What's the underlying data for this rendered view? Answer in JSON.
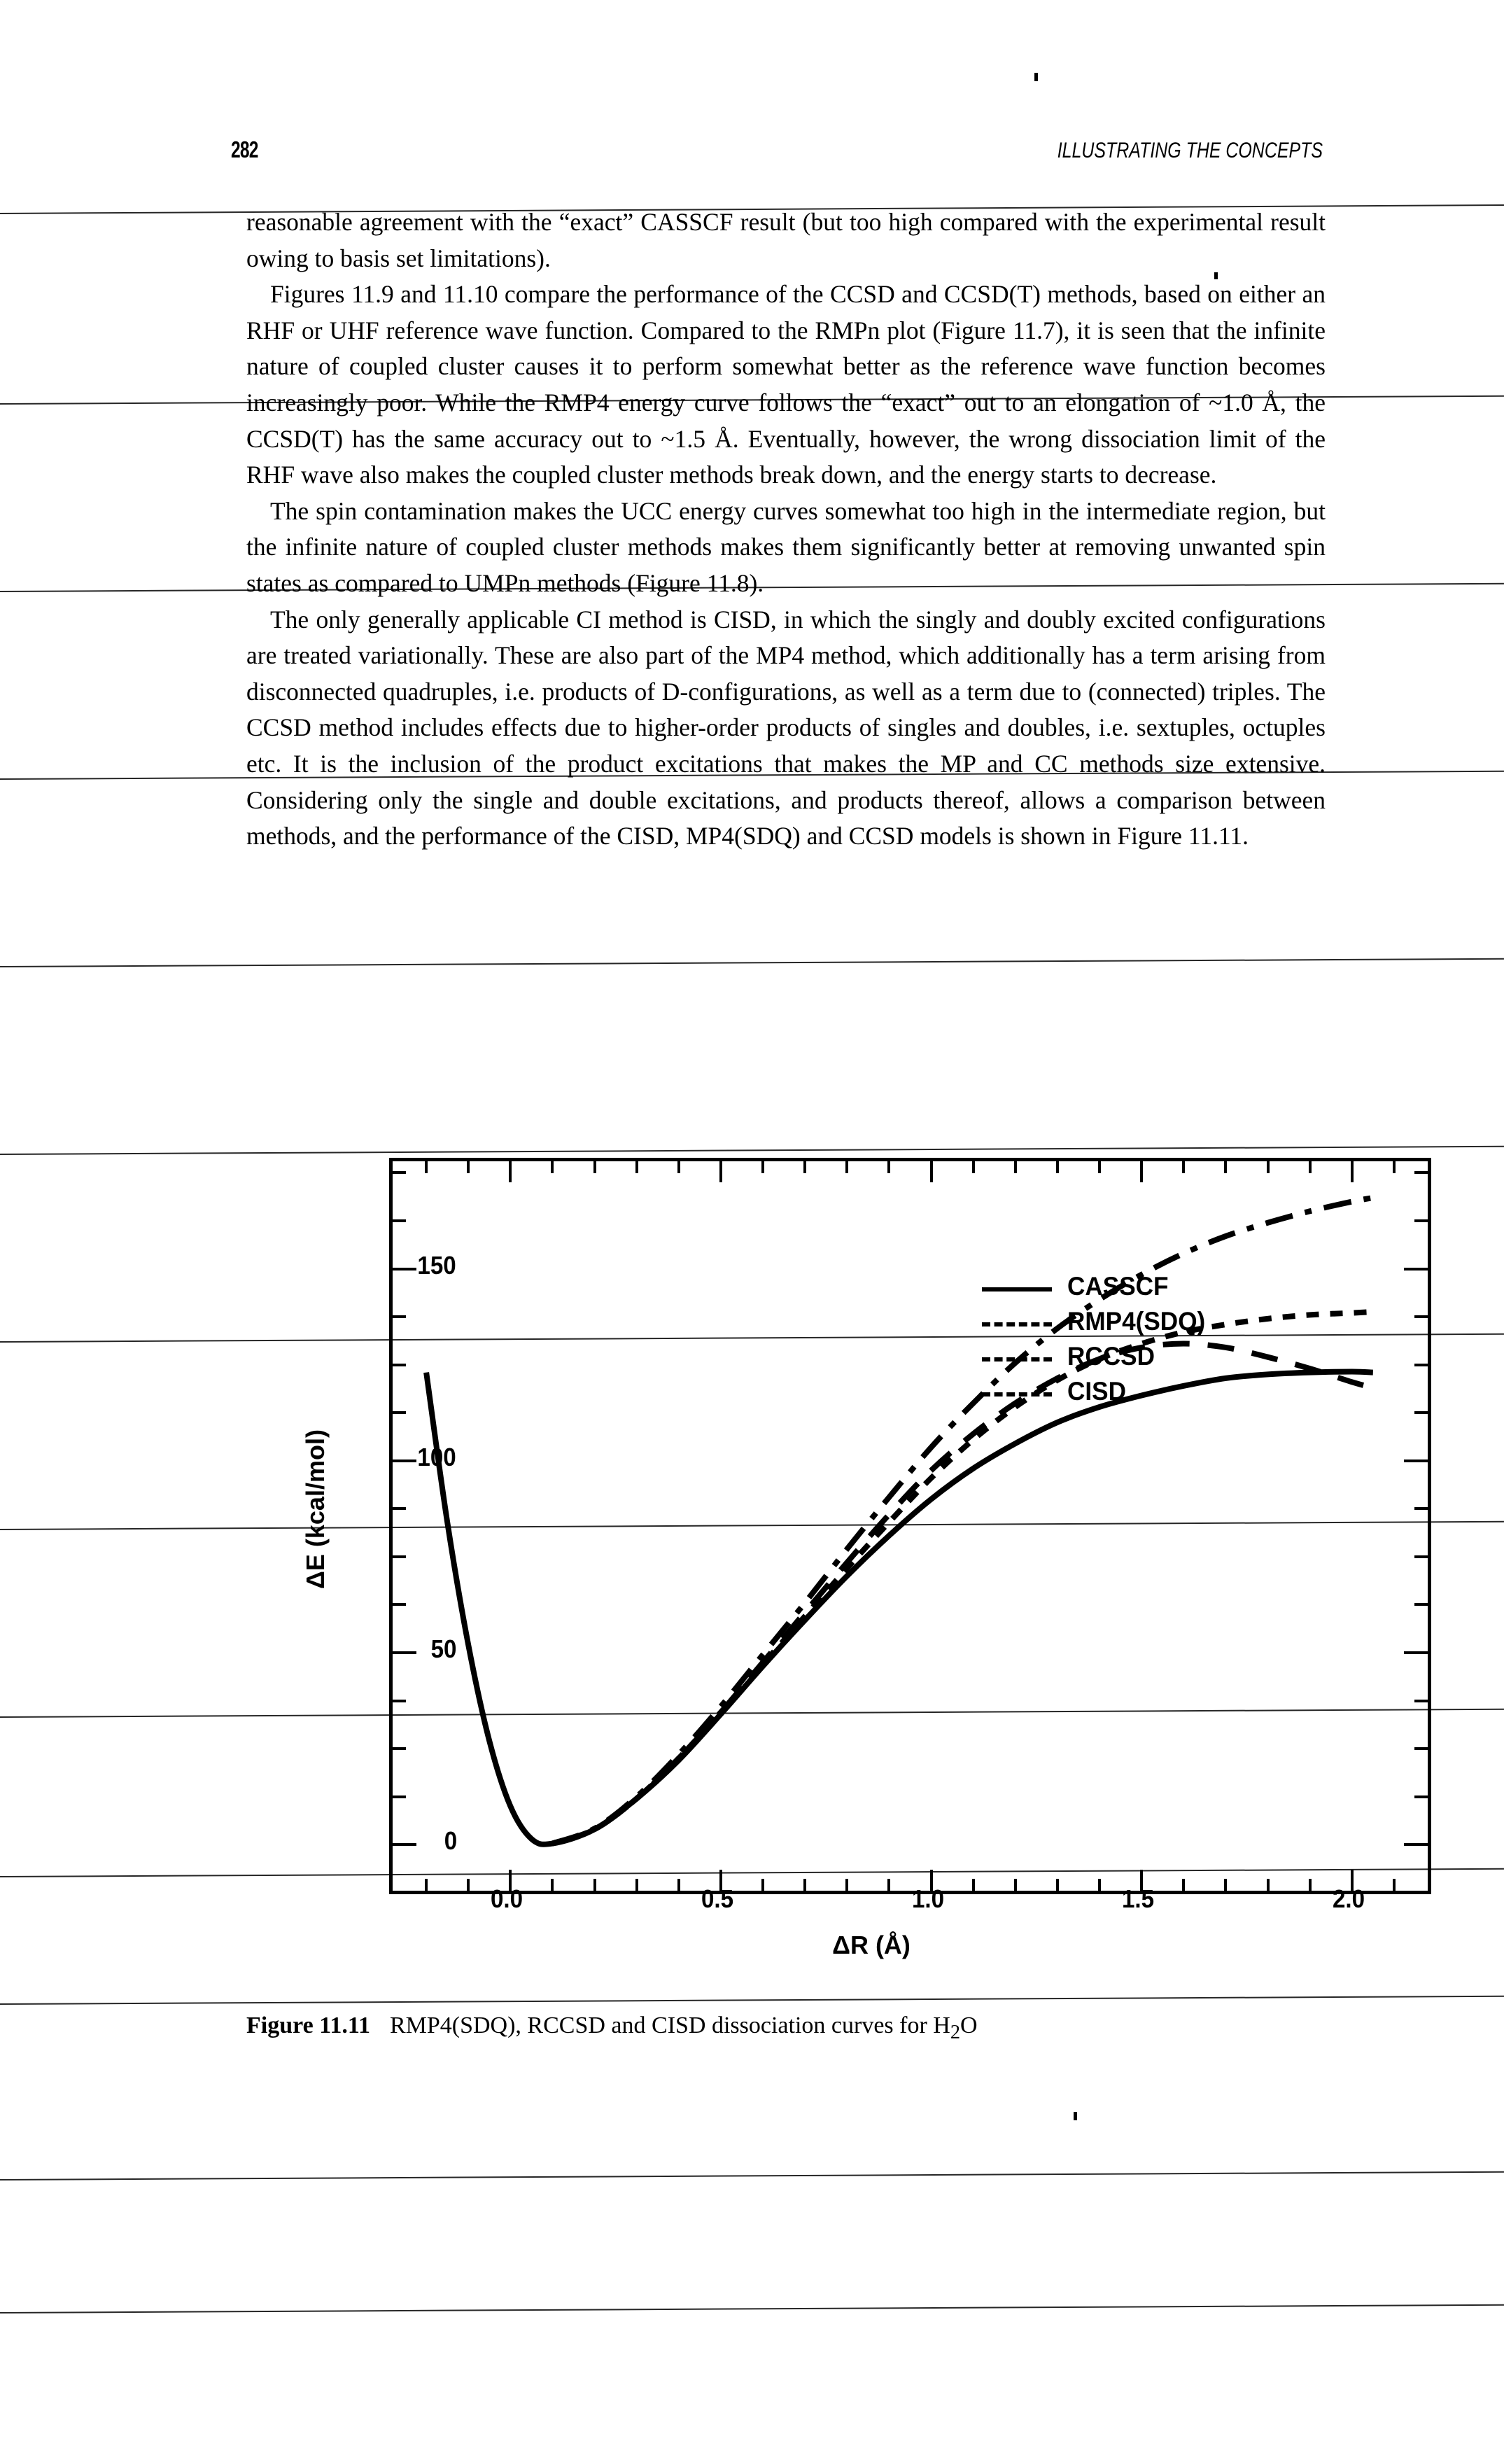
{
  "page": {
    "number": "282",
    "running_head": "ILLUSTRATING THE CONCEPTS"
  },
  "body": {
    "paragraphs": [
      "reasonable agreement with the “exact” CASSCF result (but too high compared with the experimental result owing to basis set limitations).",
      "Figures 11.9 and 11.10 compare the performance of the CCSD and CCSD(T) methods, based on either an RHF or UHF reference wave function. Compared to the RMPn plot (Figure 11.7), it is seen that the infinite nature of coupled cluster causes it to perform somewhat better as the reference wave function becomes increasingly poor. While the RMP4 energy curve follows the “exact” out to an elongation of ~1.0 Å, the CCSD(T) has the same accuracy out to ~1.5 Å. Eventually, however, the wrong dissociation limit of the RHF wave also makes the coupled cluster methods break down, and the energy starts to decrease.",
      "The spin contamination makes the UCC energy curves somewhat too high in the intermediate region, but the infinite nature of coupled cluster methods makes them significantly better at removing unwanted spin states as compared to UMPn methods (Figure 11.8).",
      "The only generally applicable CI method is CISD, in which the singly and doubly excited configurations are treated variationally. These are also part of the MP4 method, which additionally has a term arising from disconnected quadruples, i.e. products of D-configurations, as well as a term due to (connected) triples. The CCSD method includes effects due to higher-order products of singles and doubles, i.e. sextuples, octuples etc. It is the inclusion of the product excitations that makes the MP and CC methods size extensive. Considering only the single and double excitations, and products thereof, allows a comparison between methods, and the performance of the CISD, MP4(SDQ) and CCSD models is shown in Figure 11.11."
    ]
  },
  "figure": {
    "caption_number": "Figure 11.11",
    "caption_text_pre": "RMP4(SDQ), RCCSD and CISD dissociation curves for H",
    "caption_sub": "2",
    "caption_text_post": "O"
  },
  "chart_data": {
    "type": "line",
    "title": "",
    "xlabel": "ΔR (Å)",
    "ylabel": "ΔE (kcal/mol)",
    "xlim": [
      -0.28,
      2.18
    ],
    "ylim": [
      -12,
      178
    ],
    "xticks": [
      0.0,
      0.5,
      1.0,
      1.5,
      2.0
    ],
    "xtick_labels": [
      "0.0",
      "0.5",
      "1.0",
      "1.5",
      "2.0"
    ],
    "yticks": [
      0,
      50,
      100,
      150
    ],
    "ytick_labels": [
      "0",
      "50",
      "100",
      "150"
    ],
    "x_minor_step": 0.1,
    "y_minor_step": 12.5,
    "grid": false,
    "legend_position": "upper-left-inside",
    "series": [
      {
        "name": "CASSCF",
        "style": "solid",
        "x": [
          -0.2,
          -0.15,
          -0.1,
          -0.05,
          0.0,
          0.05,
          0.1,
          0.2,
          0.3,
          0.4,
          0.5,
          0.6,
          0.7,
          0.8,
          0.9,
          1.0,
          1.1,
          1.2,
          1.3,
          1.4,
          1.5,
          1.6,
          1.7,
          1.8,
          1.9,
          2.0,
          2.05
        ],
        "values": [
          123.0,
          84.0,
          52.0,
          27.0,
          10.0,
          1.5,
          0.3,
          4.0,
          12.0,
          22.0,
          34.0,
          46.5,
          58.5,
          70.0,
          80.5,
          90.0,
          98.0,
          104.5,
          110.0,
          114.0,
          117.0,
          119.5,
          121.5,
          122.5,
          123.0,
          123.2,
          123.0
        ]
      },
      {
        "name": "RMP4(SDQ)",
        "style": "longdash",
        "x": [
          0.1,
          0.2,
          0.3,
          0.4,
          0.5,
          0.6,
          0.7,
          0.8,
          0.9,
          1.0,
          1.1,
          1.2,
          1.3,
          1.4,
          1.5,
          1.6,
          1.7,
          1.8,
          1.9,
          2.0,
          2.05
        ],
        "values": [
          0.3,
          4.0,
          12.0,
          22.5,
          34.5,
          47.5,
          60.5,
          73.5,
          86.0,
          97.5,
          107.0,
          115.0,
          121.5,
          126.5,
          129.5,
          130.5,
          129.5,
          127.0,
          124.0,
          120.5,
          119.0
        ]
      },
      {
        "name": "RCCSD",
        "style": "shortdash",
        "x": [
          0.1,
          0.2,
          0.3,
          0.4,
          0.5,
          0.6,
          0.7,
          0.8,
          0.9,
          1.0,
          1.1,
          1.2,
          1.3,
          1.4,
          1.5,
          1.6,
          1.7,
          1.8,
          1.9,
          2.0,
          2.05
        ],
        "values": [
          0.3,
          4.0,
          12.0,
          22.5,
          34.5,
          47.0,
          59.5,
          72.0,
          84.0,
          95.5,
          105.5,
          114.0,
          121.0,
          126.5,
          130.5,
          133.5,
          135.5,
          137.0,
          138.0,
          138.5,
          138.8
        ]
      },
      {
        "name": "CISD",
        "style": "dashdot",
        "x": [
          0.1,
          0.2,
          0.3,
          0.4,
          0.5,
          0.6,
          0.7,
          0.8,
          0.9,
          1.0,
          1.1,
          1.2,
          1.3,
          1.4,
          1.5,
          1.6,
          1.7,
          1.8,
          1.9,
          2.0,
          2.05
        ],
        "values": [
          0.3,
          4.2,
          12.5,
          23.5,
          36.0,
          49.5,
          63.0,
          77.0,
          90.5,
          103.5,
          115.0,
          125.5,
          134.5,
          142.0,
          148.5,
          154.0,
          158.5,
          162.0,
          165.0,
          167.5,
          168.5
        ]
      }
    ]
  },
  "legend": {
    "items": [
      {
        "label": "CASSCF",
        "style": "solid"
      },
      {
        "label": "RMP4(SDQ)",
        "style": "longdash"
      },
      {
        "label": "RCCSD",
        "style": "shortdash"
      },
      {
        "label": "CISD",
        "style": "dashdot"
      }
    ]
  }
}
